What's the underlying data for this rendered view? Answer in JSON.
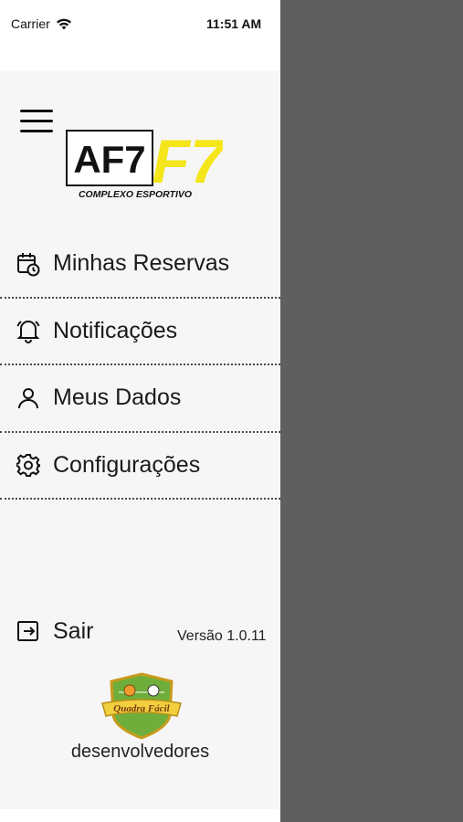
{
  "status_bar": {
    "carrier": "Carrier",
    "time": "11:51 AM"
  },
  "logo": {
    "main_text": "AF7",
    "accent_text": "F7",
    "subtitle": "COMPLEXO ESPORTIVO"
  },
  "menu": {
    "items": [
      {
        "label": "Minhas Reservas",
        "icon": "calendar-clock-icon"
      },
      {
        "label": "Notificações",
        "icon": "bell-icon"
      },
      {
        "label": "Meus Dados",
        "icon": "user-icon"
      },
      {
        "label": "Configurações",
        "icon": "gear-icon"
      }
    ]
  },
  "footer": {
    "logout_label": "Sair",
    "version": "Versão 1.0.11",
    "developer_badge_text": "Quadra Fácil",
    "developer_label": "desenvolvedores"
  },
  "colors": {
    "accent_yellow": "#f4e61a",
    "overlay": "#5f5f5f",
    "drawer_bg": "#f6f6f6"
  }
}
